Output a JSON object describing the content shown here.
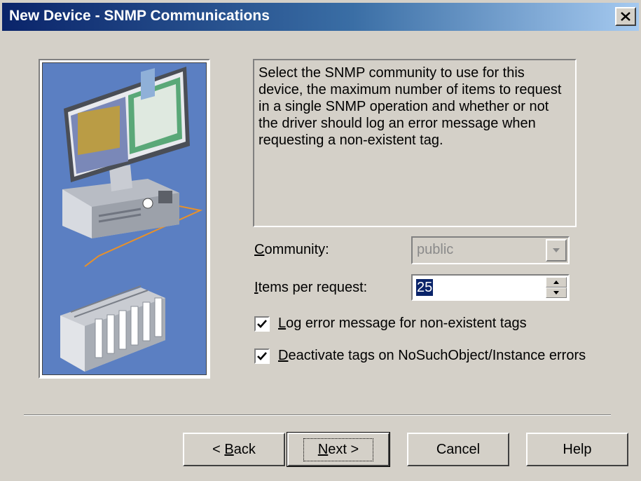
{
  "window": {
    "title": "New Device - SNMP Communications",
    "close_icon": "close-icon"
  },
  "description": "Select the SNMP community to use for this device, the maximum number of items to request in a single SNMP operation and whether or not the driver should log an error message when requesting a non-existent tag.",
  "community": {
    "label_underlined": "C",
    "label_rest": "ommunity:",
    "value": "public",
    "enabled": false
  },
  "items_per_request": {
    "label_underlined": "I",
    "label_rest": "tems per request:",
    "value": "25"
  },
  "checkboxes": [
    {
      "underlined": "L",
      "rest": "og error message for non-existent tags",
      "checked": true
    },
    {
      "underlined": "D",
      "rest": "eactivate tags on NoSuchObject/Instance errors",
      "checked": true
    }
  ],
  "buttons": {
    "back_prefix": "< ",
    "back_underlined": "B",
    "back_rest": "ack",
    "next_underlined": "N",
    "next_rest": "ext >",
    "cancel": "Cancel",
    "help": "Help"
  },
  "colors": {
    "title_gradient_start": "#0a246a",
    "title_gradient_end": "#a6caf0",
    "dialog_face": "#d4d0c8",
    "selection": "#0a246a"
  }
}
